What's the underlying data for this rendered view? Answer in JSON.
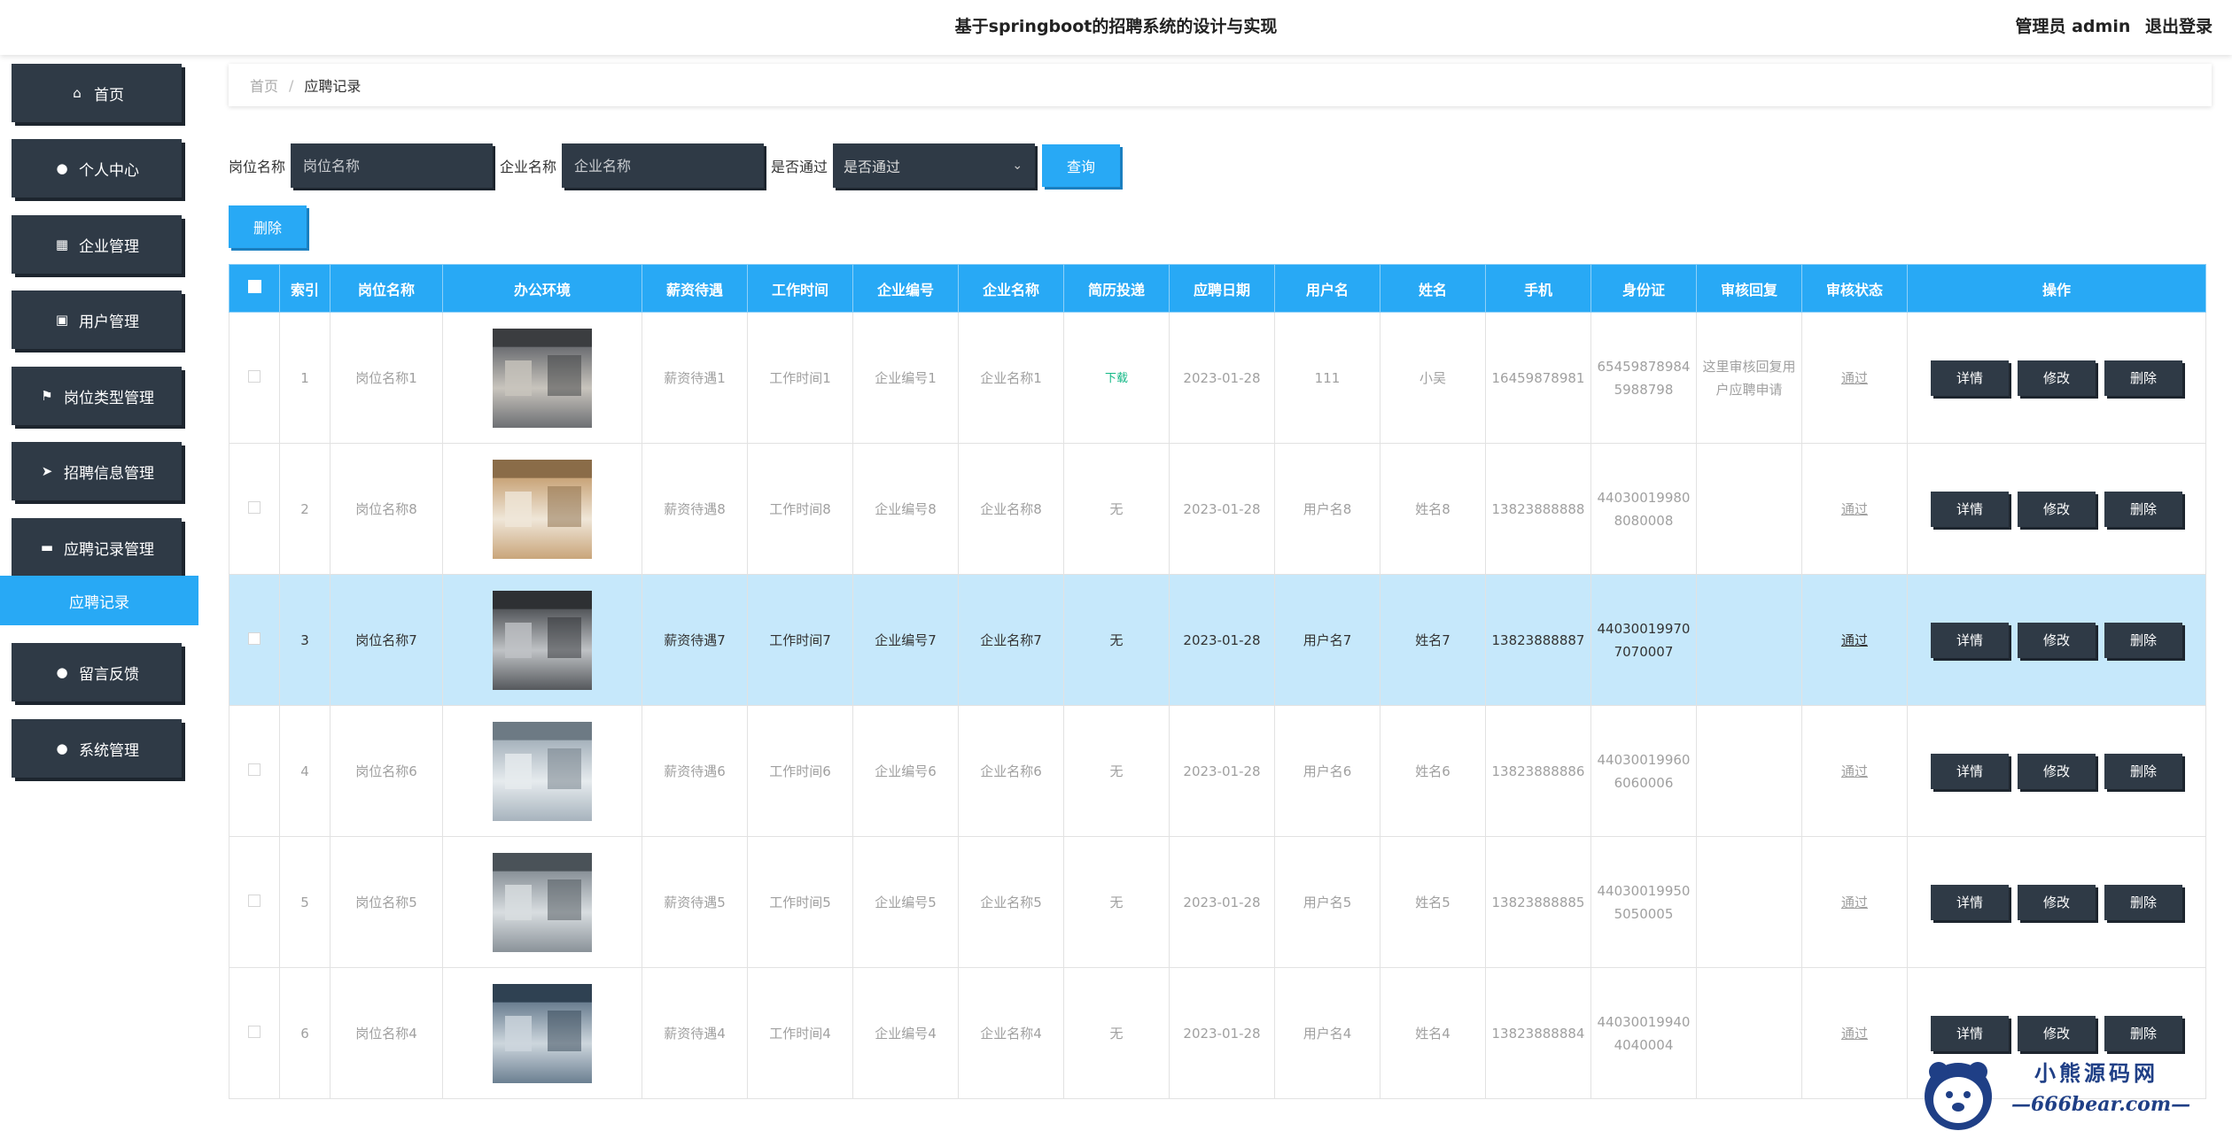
{
  "header": {
    "title": "基于springboot的招聘系统的设计与实现",
    "user": "管理员 admin",
    "logout": "退出登录"
  },
  "sidebar": {
    "items": [
      {
        "label": "首页",
        "icon": "home-icon"
      },
      {
        "label": "个人中心",
        "icon": "user-icon"
      },
      {
        "label": "企业管理",
        "icon": "grid-icon"
      },
      {
        "label": "用户管理",
        "icon": "clipboard-icon"
      },
      {
        "label": "岗位类型管理",
        "icon": "flag-icon"
      },
      {
        "label": "招聘信息管理",
        "icon": "send-icon"
      },
      {
        "label": "应聘记录管理",
        "icon": "tablet-icon"
      },
      {
        "label": "留言反馈",
        "icon": "bulb-icon"
      },
      {
        "label": "系统管理",
        "icon": "user-icon"
      }
    ],
    "submenu": "应聘记录"
  },
  "breadcrumb": {
    "home": "首页",
    "sep": "/",
    "current": "应聘记录"
  },
  "search": {
    "job_label": "岗位名称",
    "job_placeholder": "岗位名称",
    "company_label": "企业名称",
    "company_placeholder": "企业名称",
    "pass_label": "是否通过",
    "pass_value": "是否通过",
    "query_button": "查询"
  },
  "delete_button": "删除",
  "table": {
    "headers": [
      "索引",
      "岗位名称",
      "办公环境",
      "薪资待遇",
      "工作时间",
      "企业编号",
      "企业名称",
      "简历投递",
      "应聘日期",
      "用户名",
      "姓名",
      "手机",
      "身份证",
      "审核回复",
      "审核状态",
      "操作"
    ],
    "ops": [
      "详情",
      "修改",
      "删除"
    ],
    "rows": [
      {
        "index": "1",
        "job": "岗位名称1",
        "salary": "薪资待遇1",
        "time": "工作时间1",
        "code": "企业编号1",
        "company": "企业名称1",
        "resume": "下载",
        "date": "2023-01-28",
        "username": "111",
        "name": "小吴",
        "phone": "16459878981",
        "idcard": "654598789845988798",
        "reply": "这里审核回复用户应聘申请",
        "status": "通过"
      },
      {
        "index": "2",
        "job": "岗位名称8",
        "salary": "薪资待遇8",
        "time": "工作时间8",
        "code": "企业编号8",
        "company": "企业名称8",
        "resume": "无",
        "date": "2023-01-28",
        "username": "用户名8",
        "name": "姓名8",
        "phone": "13823888888",
        "idcard": "440300199808080008",
        "reply": "",
        "status": "通过"
      },
      {
        "index": "3",
        "job": "岗位名称7",
        "salary": "薪资待遇7",
        "time": "工作时间7",
        "code": "企业编号7",
        "company": "企业名称7",
        "resume": "无",
        "date": "2023-01-28",
        "username": "用户名7",
        "name": "姓名7",
        "phone": "13823888887",
        "idcard": "440300199707070007",
        "reply": "",
        "status": "通过"
      },
      {
        "index": "4",
        "job": "岗位名称6",
        "salary": "薪资待遇6",
        "time": "工作时间6",
        "code": "企业编号6",
        "company": "企业名称6",
        "resume": "无",
        "date": "2023-01-28",
        "username": "用户名6",
        "name": "姓名6",
        "phone": "13823888886",
        "idcard": "440300199606060006",
        "reply": "",
        "status": "通过"
      },
      {
        "index": "5",
        "job": "岗位名称5",
        "salary": "薪资待遇5",
        "time": "工作时间5",
        "code": "企业编号5",
        "company": "企业名称5",
        "resume": "无",
        "date": "2023-01-28",
        "username": "用户名5",
        "name": "姓名5",
        "phone": "13823888885",
        "idcard": "440300199505050005",
        "reply": "",
        "status": "通过"
      },
      {
        "index": "6",
        "job": "岗位名称4",
        "salary": "薪资待遇4",
        "time": "工作时间4",
        "code": "企业编号4",
        "company": "企业名称4",
        "resume": "无",
        "date": "2023-01-28",
        "username": "用户名4",
        "name": "姓名4",
        "phone": "13823888884",
        "idcard": "440300199404040004",
        "reply": "",
        "status": "通过"
      }
    ]
  },
  "watermark": {
    "line1": "小熊源码网",
    "line2": "—666bear.com—"
  }
}
